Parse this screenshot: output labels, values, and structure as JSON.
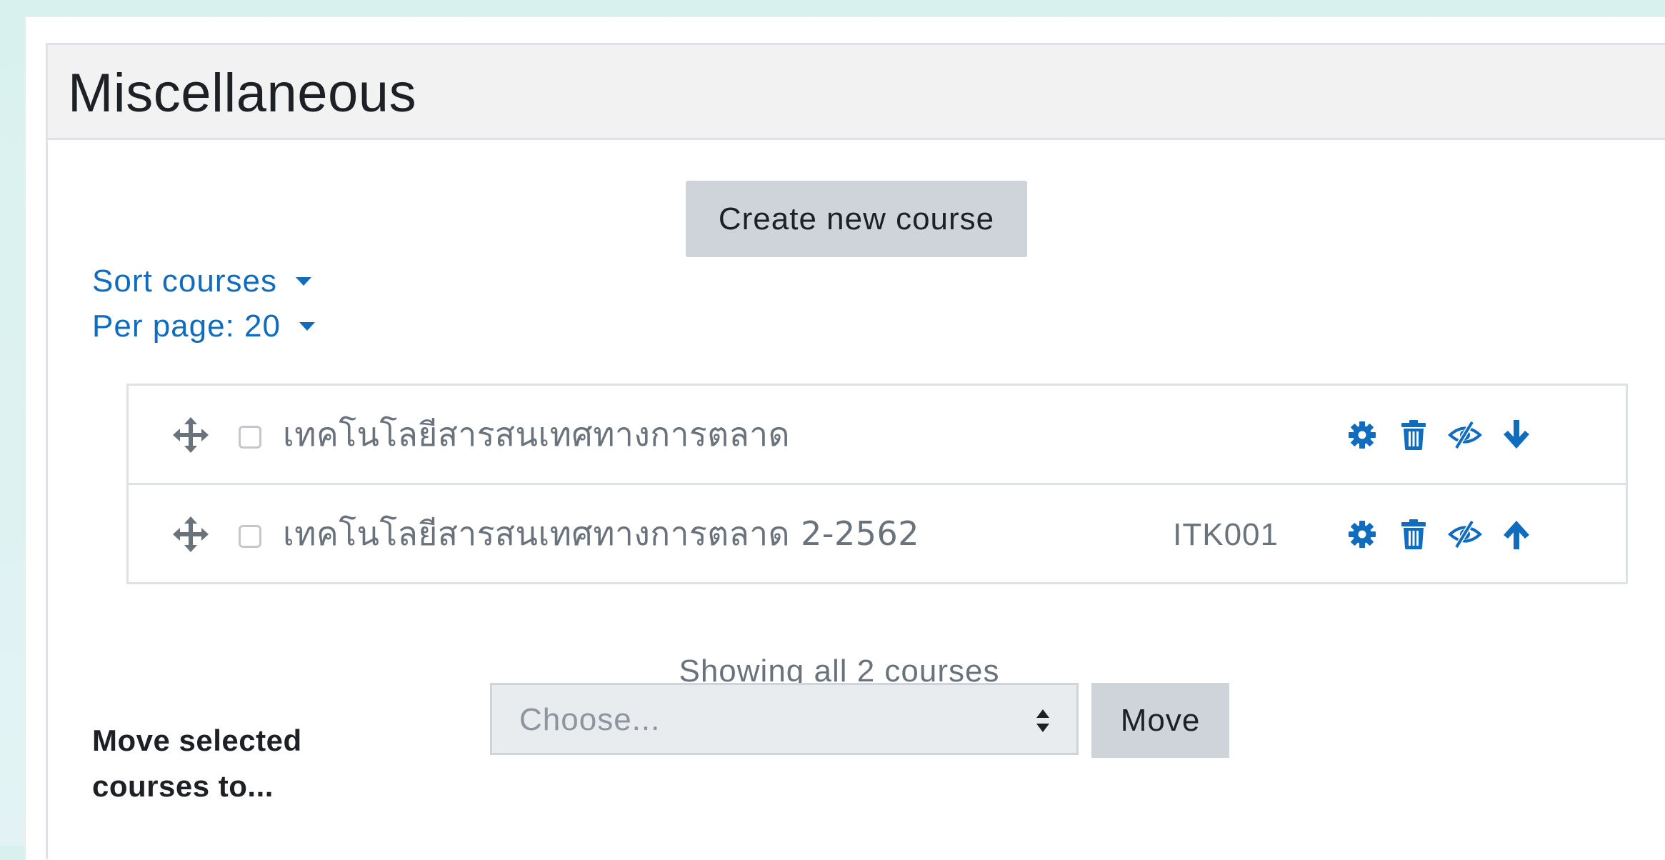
{
  "panel": {
    "title": "Miscellaneous"
  },
  "toolbar": {
    "create_label": "Create new course",
    "sort_label": "Sort courses",
    "perpage_label": "Per page: 20"
  },
  "courses": [
    {
      "name": "เทคโนโลยีสารสนเทศทางการตลาด",
      "idnumber": "",
      "actions": [
        "gear-icon",
        "trash-icon",
        "eye-slash-icon",
        "arrow-down-icon"
      ]
    },
    {
      "name": "เทคโนโลยีสารสนเทศทางการตลาด 2-2562",
      "idnumber": "ITK001",
      "actions": [
        "gear-icon",
        "trash-icon",
        "eye-slash-icon",
        "arrow-up-icon"
      ]
    }
  ],
  "listing": {
    "showing_text": "Showing all 2 courses"
  },
  "move_form": {
    "label": "Move selected courses to...",
    "select_value": "Choose...",
    "move_label": "Move"
  },
  "colors": {
    "accent": "#0f6cbf",
    "button_bg": "#ced4da",
    "muted_text": "#6a737b"
  }
}
